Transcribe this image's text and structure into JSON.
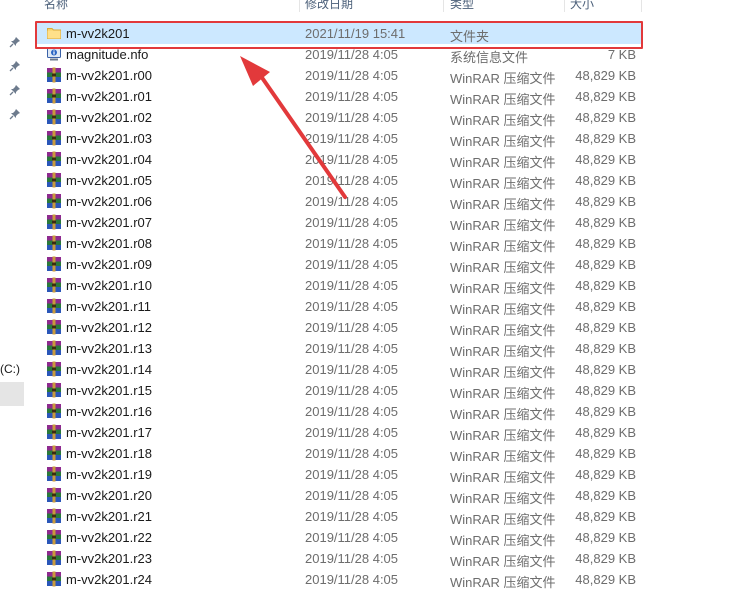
{
  "columns": {
    "name": "名称",
    "date": "修改日期",
    "type": "类型",
    "size": "大小"
  },
  "sidebar": {
    "drive_label": "(C:)"
  },
  "colors": {
    "selection": "#cce8ff",
    "annotation": "#e2393b"
  },
  "files": [
    {
      "name": "m-vv2k201",
      "date": "2021/11/19 15:41",
      "type": "文件夹",
      "size": "",
      "icon": "folder-icon"
    },
    {
      "name": "magnitude.nfo",
      "date": "2019/11/28 4:05",
      "type": "系统信息文件",
      "size": "7 KB",
      "icon": "system-info-icon"
    },
    {
      "name": "m-vv2k201.r00",
      "date": "2019/11/28 4:05",
      "type": "WinRAR 压缩文件",
      "size": "48,829 KB",
      "icon": "winrar-icon"
    },
    {
      "name": "m-vv2k201.r01",
      "date": "2019/11/28 4:05",
      "type": "WinRAR 压缩文件",
      "size": "48,829 KB",
      "icon": "winrar-icon"
    },
    {
      "name": "m-vv2k201.r02",
      "date": "2019/11/28 4:05",
      "type": "WinRAR 压缩文件",
      "size": "48,829 KB",
      "icon": "winrar-icon"
    },
    {
      "name": "m-vv2k201.r03",
      "date": "2019/11/28 4:05",
      "type": "WinRAR 压缩文件",
      "size": "48,829 KB",
      "icon": "winrar-icon"
    },
    {
      "name": "m-vv2k201.r04",
      "date": "2019/11/28 4:05",
      "type": "WinRAR 压缩文件",
      "size": "48,829 KB",
      "icon": "winrar-icon"
    },
    {
      "name": "m-vv2k201.r05",
      "date": "2019/11/28 4:05",
      "type": "WinRAR 压缩文件",
      "size": "48,829 KB",
      "icon": "winrar-icon"
    },
    {
      "name": "m-vv2k201.r06",
      "date": "2019/11/28 4:05",
      "type": "WinRAR 压缩文件",
      "size": "48,829 KB",
      "icon": "winrar-icon"
    },
    {
      "name": "m-vv2k201.r07",
      "date": "2019/11/28 4:05",
      "type": "WinRAR 压缩文件",
      "size": "48,829 KB",
      "icon": "winrar-icon"
    },
    {
      "name": "m-vv2k201.r08",
      "date": "2019/11/28 4:05",
      "type": "WinRAR 压缩文件",
      "size": "48,829 KB",
      "icon": "winrar-icon"
    },
    {
      "name": "m-vv2k201.r09",
      "date": "2019/11/28 4:05",
      "type": "WinRAR 压缩文件",
      "size": "48,829 KB",
      "icon": "winrar-icon"
    },
    {
      "name": "m-vv2k201.r10",
      "date": "2019/11/28 4:05",
      "type": "WinRAR 压缩文件",
      "size": "48,829 KB",
      "icon": "winrar-icon"
    },
    {
      "name": "m-vv2k201.r11",
      "date": "2019/11/28 4:05",
      "type": "WinRAR 压缩文件",
      "size": "48,829 KB",
      "icon": "winrar-icon"
    },
    {
      "name": "m-vv2k201.r12",
      "date": "2019/11/28 4:05",
      "type": "WinRAR 压缩文件",
      "size": "48,829 KB",
      "icon": "winrar-icon"
    },
    {
      "name": "m-vv2k201.r13",
      "date": "2019/11/28 4:05",
      "type": "WinRAR 压缩文件",
      "size": "48,829 KB",
      "icon": "winrar-icon"
    },
    {
      "name": "m-vv2k201.r14",
      "date": "2019/11/28 4:05",
      "type": "WinRAR 压缩文件",
      "size": "48,829 KB",
      "icon": "winrar-icon"
    },
    {
      "name": "m-vv2k201.r15",
      "date": "2019/11/28 4:05",
      "type": "WinRAR 压缩文件",
      "size": "48,829 KB",
      "icon": "winrar-icon"
    },
    {
      "name": "m-vv2k201.r16",
      "date": "2019/11/28 4:05",
      "type": "WinRAR 压缩文件",
      "size": "48,829 KB",
      "icon": "winrar-icon"
    },
    {
      "name": "m-vv2k201.r17",
      "date": "2019/11/28 4:05",
      "type": "WinRAR 压缩文件",
      "size": "48,829 KB",
      "icon": "winrar-icon"
    },
    {
      "name": "m-vv2k201.r18",
      "date": "2019/11/28 4:05",
      "type": "WinRAR 压缩文件",
      "size": "48,829 KB",
      "icon": "winrar-icon"
    },
    {
      "name": "m-vv2k201.r19",
      "date": "2019/11/28 4:05",
      "type": "WinRAR 压缩文件",
      "size": "48,829 KB",
      "icon": "winrar-icon"
    },
    {
      "name": "m-vv2k201.r20",
      "date": "2019/11/28 4:05",
      "type": "WinRAR 压缩文件",
      "size": "48,829 KB",
      "icon": "winrar-icon"
    },
    {
      "name": "m-vv2k201.r21",
      "date": "2019/11/28 4:05",
      "type": "WinRAR 压缩文件",
      "size": "48,829 KB",
      "icon": "winrar-icon"
    },
    {
      "name": "m-vv2k201.r22",
      "date": "2019/11/28 4:05",
      "type": "WinRAR 压缩文件",
      "size": "48,829 KB",
      "icon": "winrar-icon"
    },
    {
      "name": "m-vv2k201.r23",
      "date": "2019/11/28 4:05",
      "type": "WinRAR 压缩文件",
      "size": "48,829 KB",
      "icon": "winrar-icon"
    },
    {
      "name": "m-vv2k201.r24",
      "date": "2019/11/28 4:05",
      "type": "WinRAR 压缩文件",
      "size": "48,829 KB",
      "icon": "winrar-icon"
    }
  ]
}
